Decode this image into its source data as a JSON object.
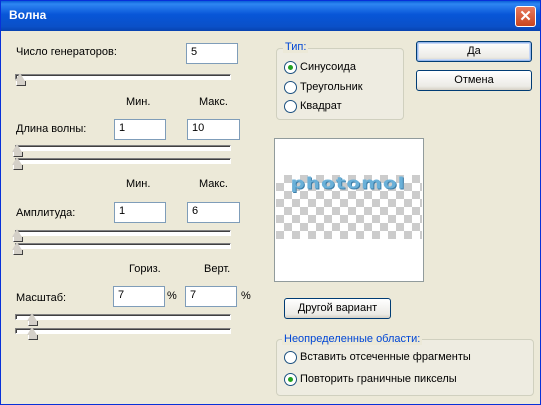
{
  "window": {
    "title": "Волна"
  },
  "generators": {
    "label": "Число генераторов:",
    "value": "5"
  },
  "range_headers": {
    "min": "Мин.",
    "max": "Макс."
  },
  "wavelength": {
    "label": "Длина волны:",
    "min": "1",
    "max": "10"
  },
  "amplitude": {
    "label": "Амплитуда:",
    "min": "1",
    "max": "6"
  },
  "scale_headers": {
    "horiz": "Гориз.",
    "vert": "Верт."
  },
  "scale": {
    "label": "Масштаб:",
    "horiz": "7",
    "vert": "7",
    "unit": "%"
  },
  "type_group": {
    "legend": "Тип:",
    "options": [
      "Синусоида",
      "Треугольник",
      "Квадрат"
    ],
    "selected": 0
  },
  "buttons": {
    "ok": "Да",
    "cancel": "Отмена",
    "randomize": "Другой вариант"
  },
  "preview": {
    "sample_text": "photomol"
  },
  "undefined_areas": {
    "legend": "Неопределенные области:",
    "options": [
      "Вставить отсеченные фрагменты",
      "Повторить граничные пикселы"
    ],
    "selected": 1
  },
  "sliders": {
    "generators": 0.01,
    "wavelength_min": 0.0,
    "wavelength_max": 0.0,
    "amplitude_min": 0.0,
    "amplitude_max": 0.0,
    "scale_horiz": 0.07,
    "scale_vert": 0.07
  }
}
